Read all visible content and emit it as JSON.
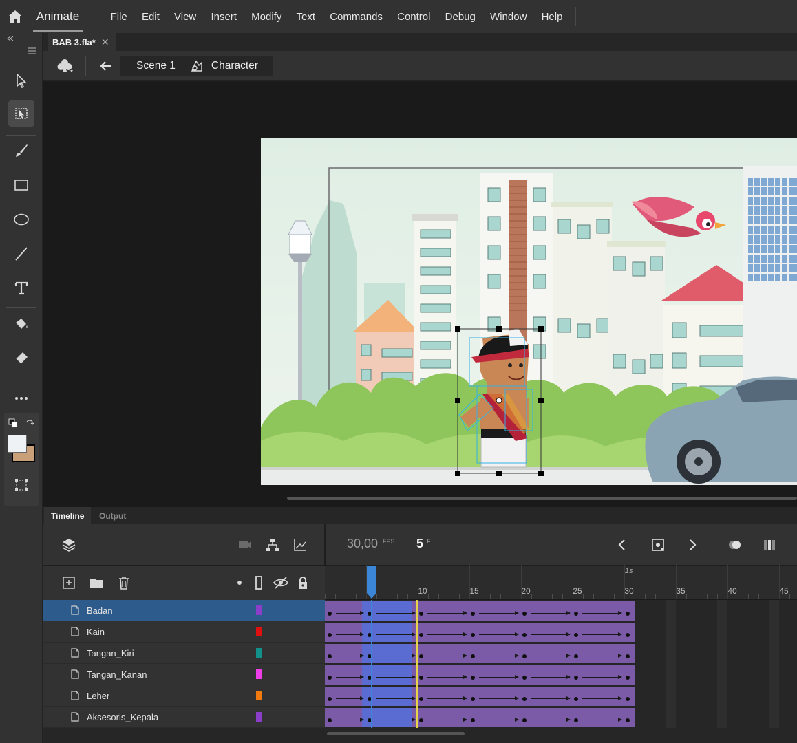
{
  "app": {
    "name": "Animate"
  },
  "menu": [
    "File",
    "Edit",
    "View",
    "Insert",
    "Modify",
    "Text",
    "Commands",
    "Control",
    "Debug",
    "Window",
    "Help"
  ],
  "document": {
    "tab_title": "BAB 3.fla*",
    "close_glyph": "✕"
  },
  "breadcrumb": {
    "scene": "Scene 1",
    "symbol": "Character"
  },
  "tools": [
    {
      "name": "selection-tool",
      "icon": "arrow-icon"
    },
    {
      "name": "free-transform-tool",
      "icon": "free-transform-icon",
      "active": true
    },
    {
      "name": "brush-tool",
      "icon": "brush-icon"
    },
    {
      "name": "rectangle-tool",
      "icon": "rectangle-icon"
    },
    {
      "name": "oval-tool",
      "icon": "oval-icon"
    },
    {
      "name": "line-tool",
      "icon": "line-icon"
    },
    {
      "name": "text-tool",
      "icon": "text-icon"
    },
    {
      "name": "paint-bucket-tool",
      "icon": "paint-bucket-icon"
    },
    {
      "name": "eraser-tool",
      "icon": "eraser-icon"
    },
    {
      "name": "more-tools",
      "icon": "ellipsis-icon"
    }
  ],
  "colors": {
    "accent": "#2d5b8c",
    "span": "#7b5aa8",
    "selected_span": "#5a6bd1",
    "playhead": "#3b86d6",
    "marker": "#e7d34a"
  },
  "timeline": {
    "tabs": [
      "Timeline",
      "Output"
    ],
    "fps": "30,00",
    "fps_unit": "FPS",
    "current_frame": "5",
    "frame_unit": "F",
    "second_marker": "1s",
    "ruler_numbers": [
      "5",
      "10",
      "15",
      "20",
      "25",
      "30",
      "35",
      "40",
      "45"
    ],
    "layers": [
      {
        "name": "Badan",
        "color": "#8b3fc9",
        "selected": true
      },
      {
        "name": "Kain",
        "color": "#e01010"
      },
      {
        "name": "Tangan_Kiri",
        "color": "#11918a"
      },
      {
        "name": "Tangan_Kanan",
        "color": "#ee3ee8"
      },
      {
        "name": "Leher",
        "color": "#f07a10"
      },
      {
        "name": "Aksesoris_Kepala",
        "color": "#8b3fc9"
      }
    ],
    "keyframes": [
      1,
      5,
      10,
      15,
      20,
      25,
      30
    ]
  }
}
